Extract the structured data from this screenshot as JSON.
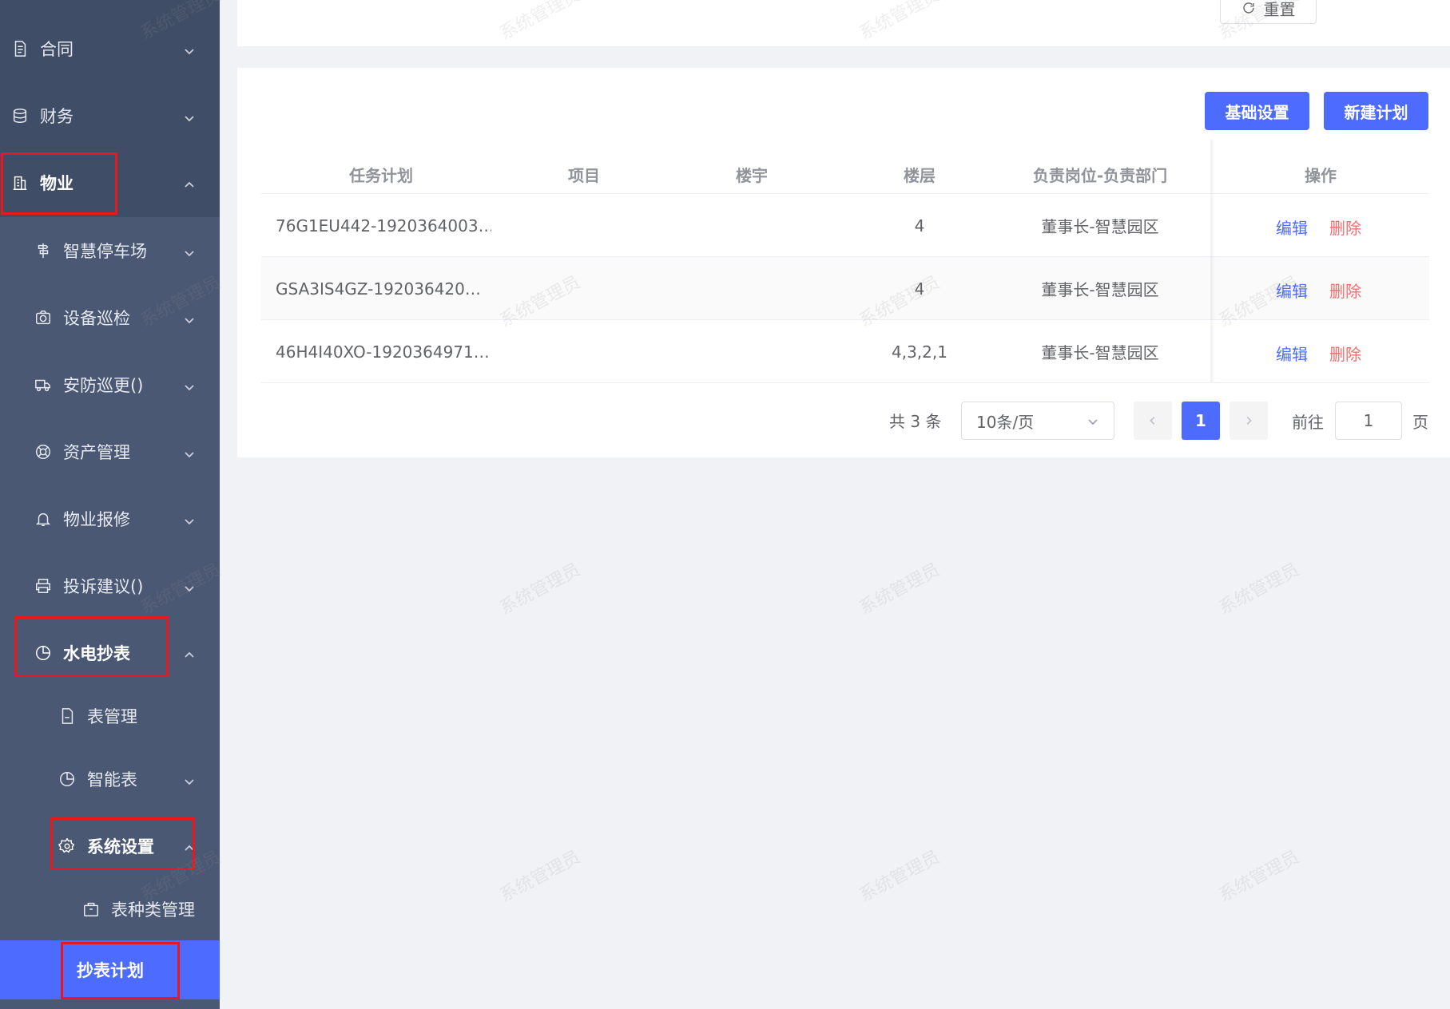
{
  "watermark": "系统管理员",
  "sidebar": {
    "items": [
      {
        "label": "合同",
        "icon": "document-icon"
      },
      {
        "label": "财务",
        "icon": "database-icon"
      },
      {
        "label": "物业",
        "icon": "building-icon"
      },
      {
        "label": "智慧停车场",
        "icon": "parking-icon"
      },
      {
        "label": "设备巡检",
        "icon": "camera-icon"
      },
      {
        "label": "安防巡更()",
        "icon": "truck-icon"
      },
      {
        "label": "资产管理",
        "icon": "lifebuoy-icon"
      },
      {
        "label": "物业报修",
        "icon": "bell-icon"
      },
      {
        "label": "投诉建议()",
        "icon": "printer-icon"
      },
      {
        "label": "水电抄表",
        "icon": "pie-chart-icon"
      },
      {
        "label": "表管理",
        "icon": "file-icon"
      },
      {
        "label": "智能表",
        "icon": "pie-chart-icon"
      },
      {
        "label": "系统设置",
        "icon": "gear-icon"
      },
      {
        "label": "表种类管理",
        "icon": "box-icon"
      },
      {
        "label": "抄表计划",
        "icon": ""
      }
    ]
  },
  "filter": {
    "reset_label": "重置"
  },
  "toolbar": {
    "basic_settings_label": "基础设置",
    "new_plan_label": "新建计划"
  },
  "table": {
    "columns": [
      "任务计划",
      "项目",
      "楼宇",
      "楼层",
      "负责岗位-负责部门",
      "操作"
    ],
    "rows": [
      {
        "plan": "76G1EU442-1920364003…",
        "project": "",
        "building": "",
        "floor": "4",
        "dept": "董事长-智慧园区",
        "edit": "编辑",
        "delete": "删除"
      },
      {
        "plan": "GSA3IS4GZ-192036420…",
        "project": "",
        "building": "",
        "floor": "4",
        "dept": "董事长-智慧园区",
        "edit": "编辑",
        "delete": "删除"
      },
      {
        "plan": "46H4I40XO-1920364971…",
        "project": "",
        "building": "",
        "floor": "4,3,2,1",
        "dept": "董事长-智慧园区",
        "edit": "编辑",
        "delete": "删除"
      }
    ]
  },
  "pagination": {
    "total_text": "共 3 条",
    "page_size": "10条/页",
    "current_page": "1",
    "goto_label": "前往",
    "goto_value": "1",
    "page_suffix": "页"
  },
  "colors": {
    "sidebar_bg": "#3f4d67",
    "primary": "#4d6bfe",
    "danger": "#f56c6c",
    "highlight": "#e8181c"
  }
}
